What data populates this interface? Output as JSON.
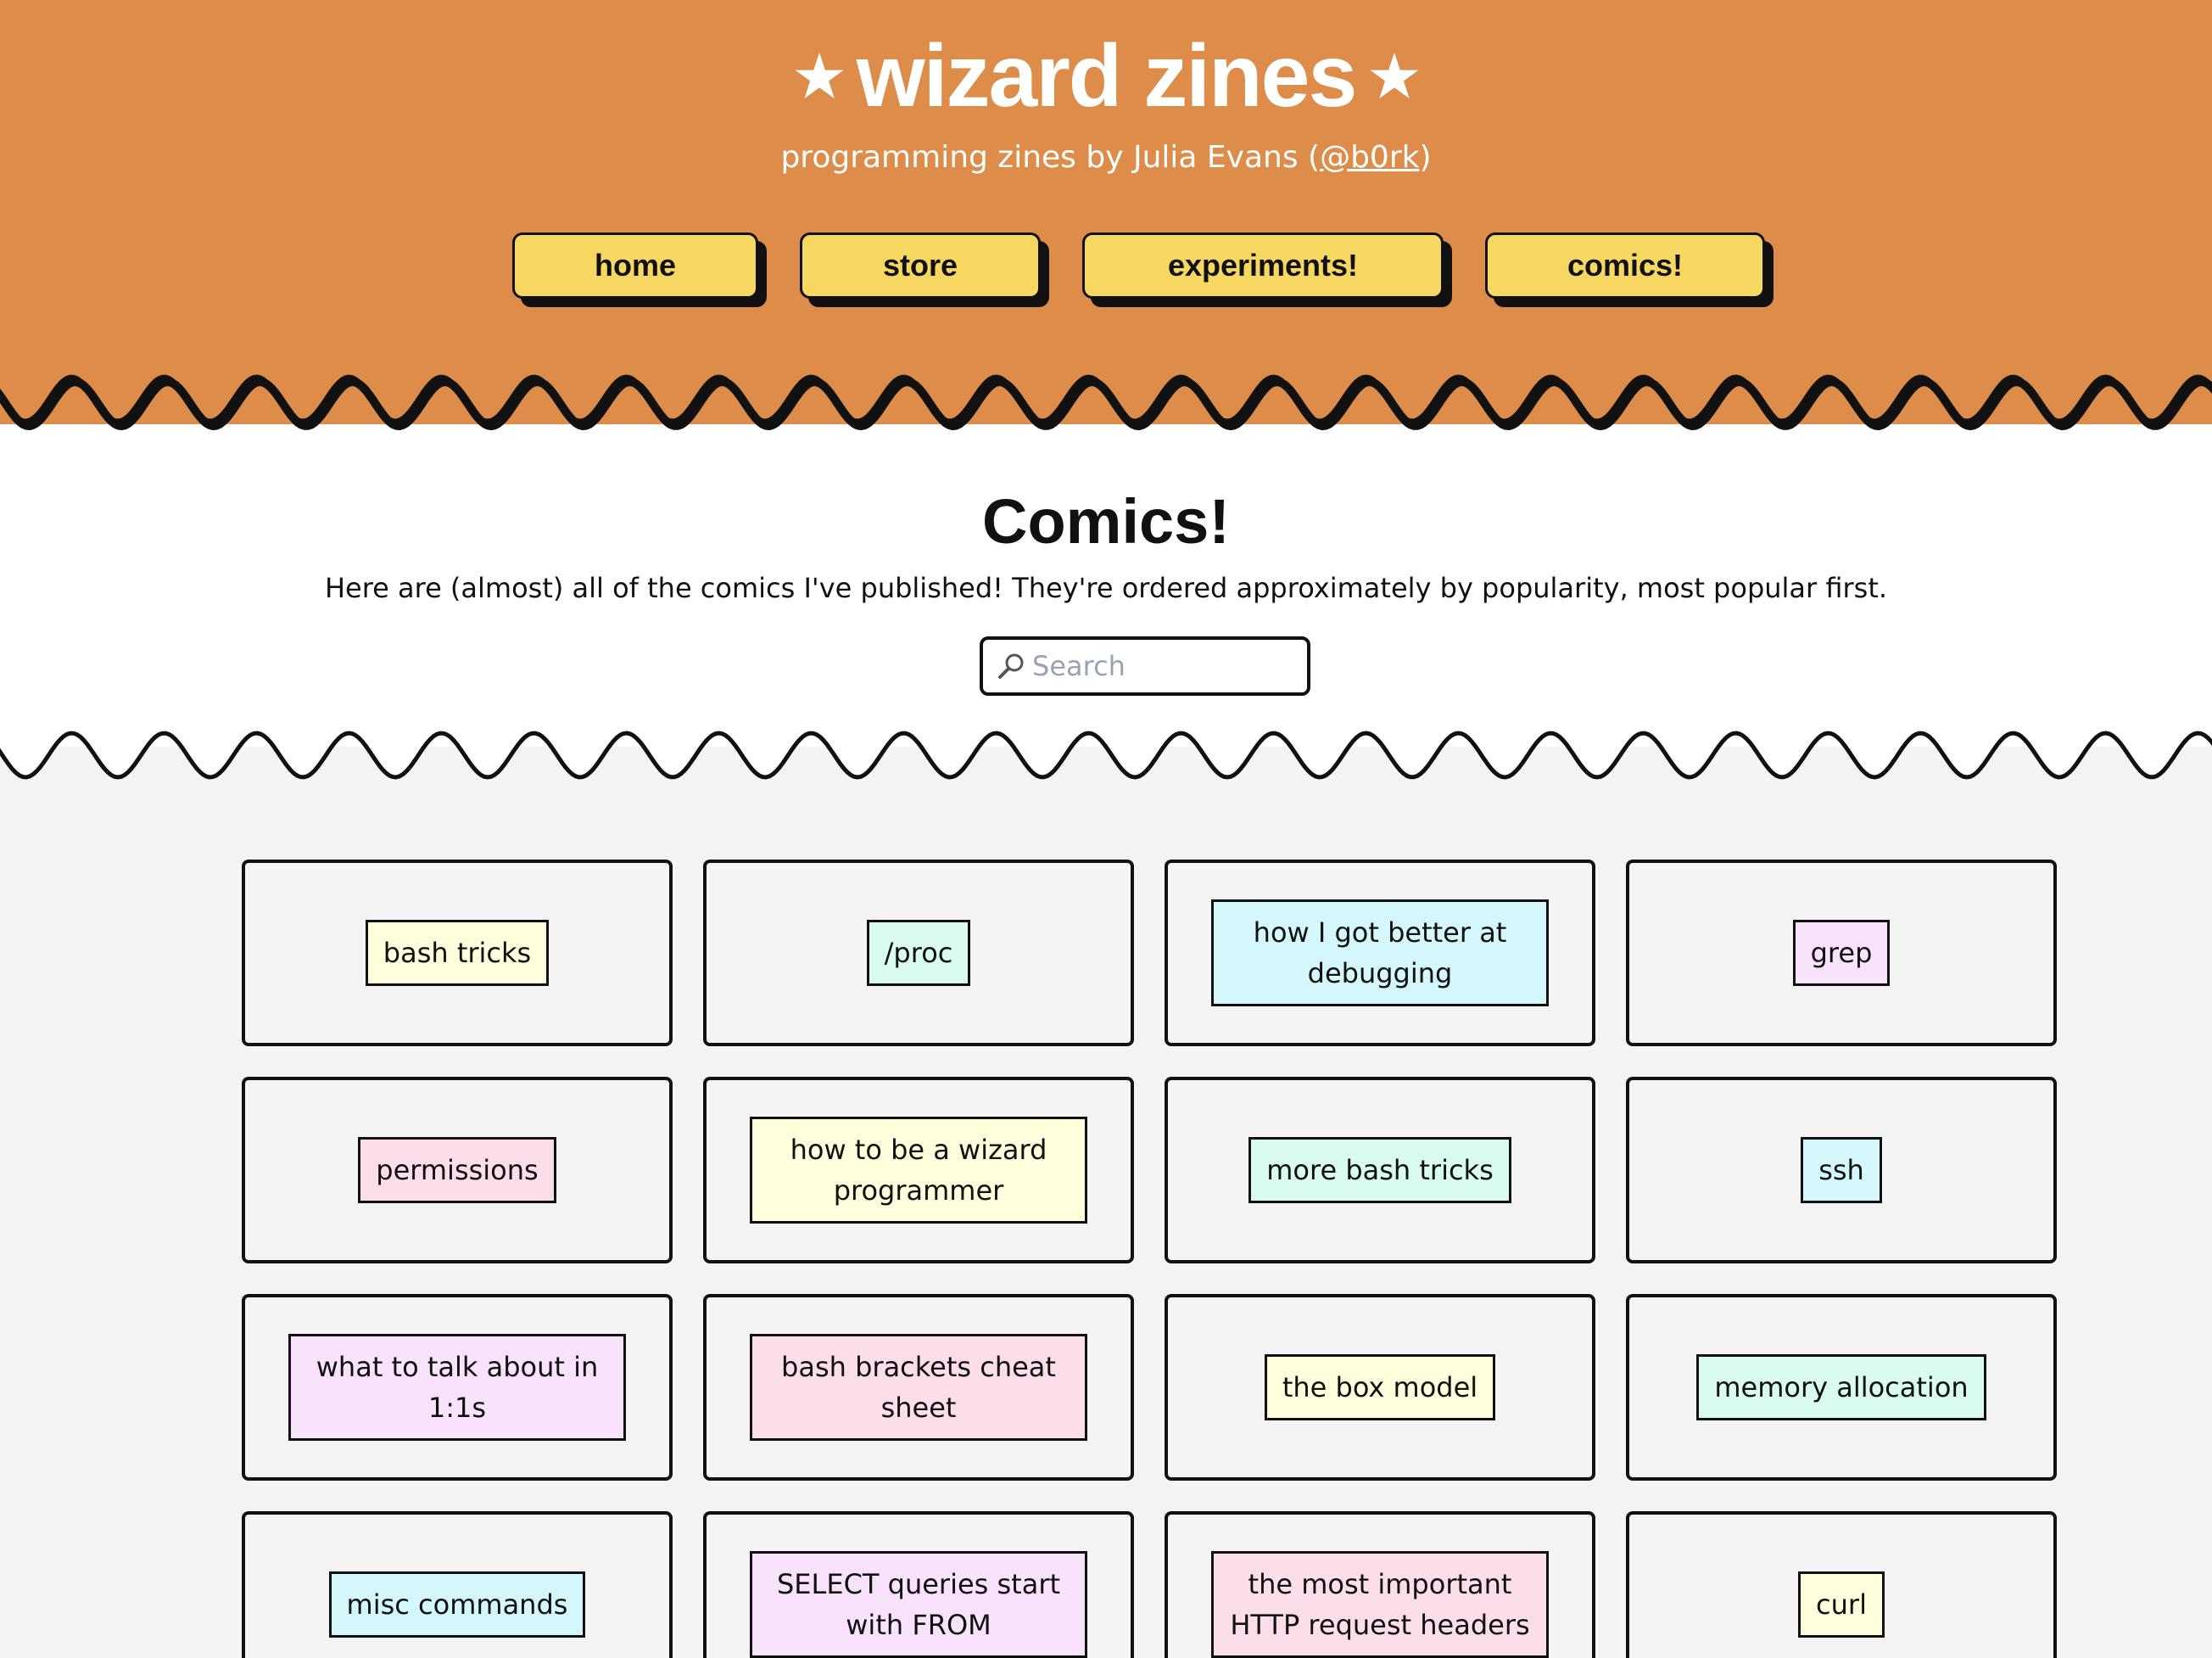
{
  "header": {
    "star": "★",
    "title": "wizard zines",
    "subtitle_prefix": "programming zines by Julia Evans (",
    "subtitle_handle": "@b0rk",
    "subtitle_suffix": ")",
    "nav": [
      {
        "label": "home"
      },
      {
        "label": "store"
      },
      {
        "label": "experiments!"
      },
      {
        "label": "comics!"
      }
    ]
  },
  "main": {
    "title": "Comics!",
    "intro": "Here are (almost) all of the comics I've published! They're ordered approximately by popularity, most popular first.",
    "search": {
      "placeholder": "Search",
      "value": ""
    }
  },
  "colors": {
    "header_bg": "#de8c4a",
    "nav_bg": "#f6d762",
    "tag_yellow": "#ffffdd",
    "tag_mint": "#d9fcee",
    "tag_cyan": "#d4f7fc",
    "tag_lavender": "#f9e2fb",
    "tag_pink": "#fbdeea"
  },
  "comics": [
    {
      "label": "bash tricks",
      "color": "#ffffdd"
    },
    {
      "label": "/proc",
      "color": "#d9fcee"
    },
    {
      "label": "how I got better at debugging",
      "color": "#d4f7fc"
    },
    {
      "label": "grep",
      "color": "#f9e2fb"
    },
    {
      "label": "permissions",
      "color": "#fbdeea"
    },
    {
      "label": "how to be a wizard programmer",
      "color": "#ffffdd"
    },
    {
      "label": "more bash tricks",
      "color": "#d9fcee"
    },
    {
      "label": "ssh",
      "color": "#d4f7fc"
    },
    {
      "label": "what to talk about in 1:1s",
      "color": "#f9e2fb"
    },
    {
      "label": "bash brackets cheat sheet",
      "color": "#fbdeea"
    },
    {
      "label": "the box model",
      "color": "#ffffdd"
    },
    {
      "label": "memory allocation",
      "color": "#d9fcee"
    },
    {
      "label": "misc commands",
      "color": "#d4f7fc"
    },
    {
      "label": "SELECT queries start with FROM",
      "color": "#f9e2fb"
    },
    {
      "label": "the most important HTTP request headers",
      "color": "#fbdeea"
    },
    {
      "label": "curl",
      "color": "#ffffdd"
    }
  ]
}
